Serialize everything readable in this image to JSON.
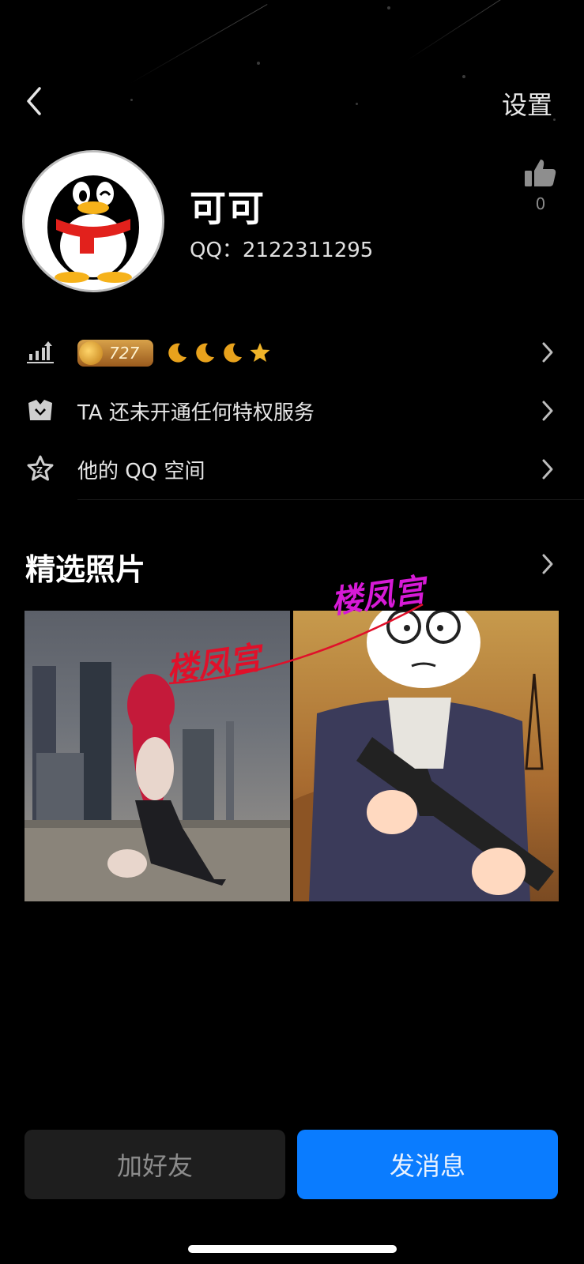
{
  "header": {
    "settings_label": "设置",
    "back_icon": "chevron-left-icon"
  },
  "profile": {
    "nickname": "可可",
    "qq_label": "QQ：2122311295",
    "like_count": "0",
    "avatar_icon": "qq-penguin-avatar"
  },
  "rows": {
    "level": {
      "value": "727",
      "icons": [
        "moon-icon",
        "moon-icon",
        "moon-icon",
        "star-icon"
      ]
    },
    "privilege": {
      "label": "TA 还未开通任何特权服务"
    },
    "qzone": {
      "label": "他的 QQ 空间"
    }
  },
  "photos": {
    "title": "精选照片",
    "watermark": "楼凤宫"
  },
  "actions": {
    "add_friend": "加好友",
    "send_message": "发消息"
  },
  "colors": {
    "accent_blue": "#0a7cff",
    "watermark_red": "#e0102a",
    "watermark_magenta": "#d61ad6"
  }
}
